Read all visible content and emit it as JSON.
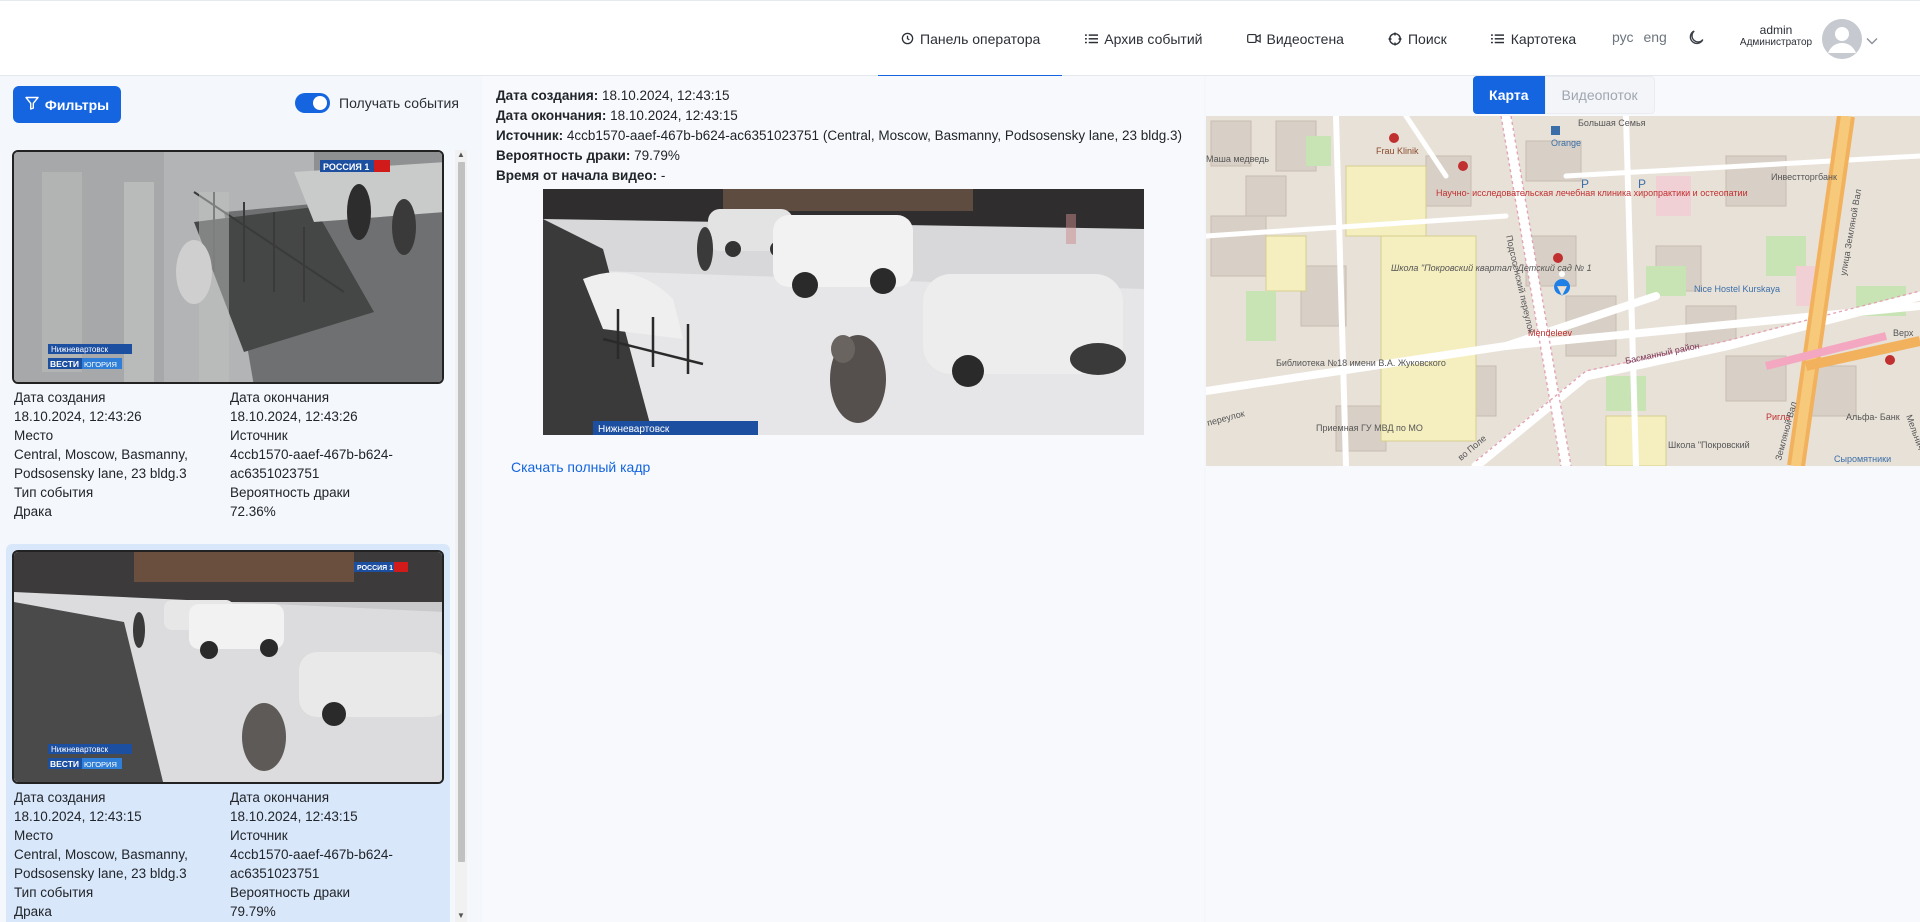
{
  "nav": {
    "items": [
      {
        "label": "Панель оператора",
        "icon": "clock-icon",
        "active": true
      },
      {
        "label": "Архив событий",
        "icon": "list-icon",
        "active": false
      },
      {
        "label": "Видеостена",
        "icon": "video-camera-icon",
        "active": false
      },
      {
        "label": "Поиск",
        "icon": "crosshair-icon",
        "active": false
      },
      {
        "label": "Картотека",
        "icon": "list-icon",
        "active": false
      }
    ],
    "lang_ru": "рус",
    "lang_en": "eng"
  },
  "user": {
    "name": "admin",
    "role": "Администратор"
  },
  "left": {
    "filter_label": "Фильтры",
    "toggle_label": "Получать события"
  },
  "events": [
    {
      "created_label": "Дата создания",
      "created": "18.10.2024, 12:43:26",
      "ended_label": "Дата окончания",
      "ended": "18.10.2024, 12:43:26",
      "place_label": "Место",
      "place": "Central, Moscow, Basmanny, Podsosensky lane, 23 bldg.3",
      "source_label": "Источник",
      "source": "4ccb1570-aaef-467b-b624-ac6351023751",
      "type_label": "Тип события",
      "type": "Драка",
      "prob_label": "Вероятность драки",
      "prob": "72.36%",
      "overlay_city": "Нижневартовск",
      "overlay_brand": "ВЕСТИ",
      "overlay_region": "ЮГОРИЯ",
      "overlay_channel": "РОССИЯ 1"
    },
    {
      "created_label": "Дата создания",
      "created": "18.10.2024, 12:43:15",
      "ended_label": "Дата окончания",
      "ended": "18.10.2024, 12:43:15",
      "place_label": "Место",
      "place": "Central, Moscow, Basmanny, Podsosensky lane, 23 bldg.3",
      "source_label": "Источник",
      "source": "4ccb1570-aaef-467b-b624-ac6351023751",
      "type_label": "Тип события",
      "type": "Драка",
      "prob_label": "Вероятность драки",
      "prob": "79.79%",
      "overlay_city": "Нижневартовск",
      "overlay_brand": "ВЕСТИ",
      "overlay_region": "ЮГОРИЯ",
      "overlay_channel": "РОССИЯ 1"
    }
  ],
  "detail": {
    "created_label": "Дата создания",
    "created": "18.10.2024, 12:43:15",
    "ended_label": "Дата окончания",
    "ended": "18.10.2024, 12:43:15",
    "source_label": "Источник",
    "source": "4ccb1570-aaef-467b-b624-ac6351023751 (Central, Moscow, Basmanny, Podsosensky lane, 23 bldg.3)",
    "prob_label": "Вероятность драки",
    "prob": "79.79%",
    "time_label": "Время от начала видео",
    "time": "-",
    "frame_city": "Нижневартовск",
    "download_label": "Скачать полный кадр"
  },
  "map_panel": {
    "tab_map": "Карта",
    "tab_stream": "Видеопоток",
    "labels": {
      "frau_klinik": "Frau Klinik",
      "orange": "Orange",
      "family": "Большая Семья",
      "clinic": "Научно- исследовательская лечебная клиника хиропрактики и остеопатии",
      "school": "Школа \"Покровский квартал\" Детский сад № 1",
      "library": "Библиотека №18 имени В.А. Жуковского",
      "police": "Приемная ГУ МВД по МО",
      "mendeleev": "Mendeleev",
      "hostel": "Nice Hostel Kurskaya",
      "investtorg": "Инвестторгбанк",
      "alfa": "Альфа- Банк",
      "rigla": "Ригла",
      "school2": "Школа \"Покровский",
      "street_podsosensky": "Подсосенский переулок",
      "street_zemlyanoy": "улица Земляной Вал",
      "street_basmanny": "Басманный район",
      "street_masha": "Маша медведь",
      "street_pole": "во Поле",
      "street_pereulok": "переулок",
      "syromyatniki": "Сыромятники",
      "verkh": "Верх",
      "zem_val": "Земляной Вал",
      "melnichn": "Мельнич"
    }
  }
}
